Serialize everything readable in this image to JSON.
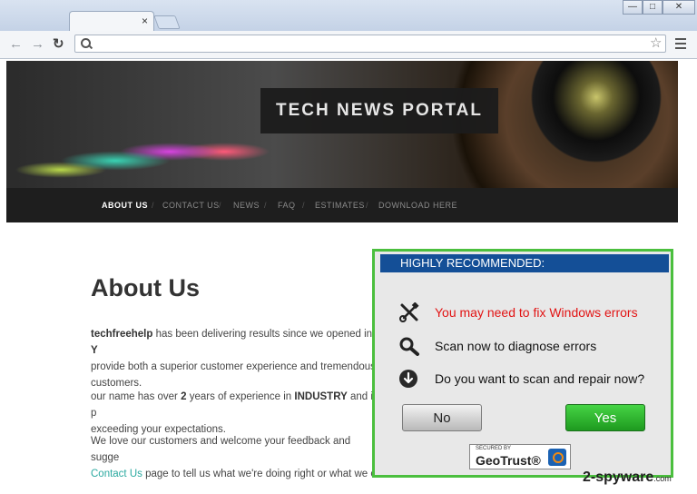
{
  "browser": {
    "tab_close": "×",
    "window_controls": [
      "—",
      "□",
      "✕"
    ],
    "back_icon": "←",
    "forward_icon": "→",
    "reload_icon": "↻",
    "star_icon": "☆",
    "url_value": ""
  },
  "site": {
    "title": "TECH NEWS PORTAL",
    "nav": [
      "ABOUT US",
      "CONTACT US",
      "NEWS",
      "FAQ",
      "ESTIMATES",
      "DOWNLOAD HERE"
    ],
    "nav_sep": "/",
    "heading": "About Us",
    "p1_brand": "techfreehelp",
    "p1_a": " has been delivering results since we opened in ",
    "p1_b": "Y",
    "p1_line2": "provide both a superior customer experience and tremendous",
    "p1_line3": "customers.",
    "p2_a": "our name has over ",
    "p2_years": "2",
    "p2_b": " years of experience in ",
    "p2_industry": "INDUSTRY",
    "p2_c": " and is p",
    "p2_line2": "exceeding your expectations.",
    "p3_line1": "We love our customers and welcome your feedback and sugge",
    "p3_link": "Contact Us",
    "p3_rest": " page to tell us what we're doing right or what we c"
  },
  "popup": {
    "header": "HIGHLY RECOMMENDED:",
    "items": [
      {
        "icon": "tools-icon",
        "text": "You may need to fix Windows errors"
      },
      {
        "icon": "magnifier-icon",
        "text": "Scan now to diagnose errors"
      },
      {
        "icon": "download-arrow-icon",
        "text": "Do you want to scan and repair now?"
      }
    ],
    "no_label": "No",
    "yes_label": "Yes",
    "badge_secured": "SECURED BY",
    "badge_brand": "GeoTrust®"
  },
  "watermark": {
    "brand": "2-spyware",
    "tld": ".com"
  },
  "colors": {
    "popup_border": "#4bbf3e",
    "popup_header": "#144f97",
    "warning_text": "#e21414",
    "yes_button": "#2fb52f",
    "link": "#2ba9a0"
  }
}
